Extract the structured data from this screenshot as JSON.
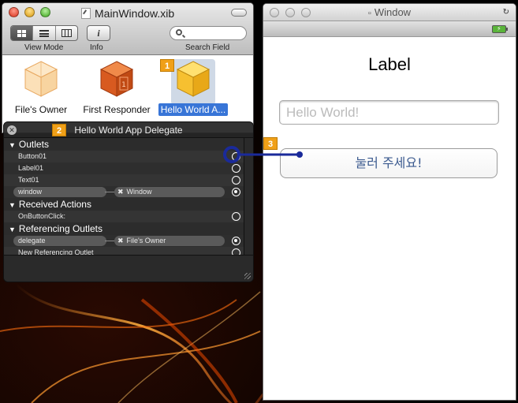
{
  "xib_window": {
    "title": "MainWindow.xib",
    "view_mode_label": "View Mode",
    "info_label": "Info",
    "search_label": "Search Field",
    "objects": [
      {
        "label": "File's Owner"
      },
      {
        "label": "First Responder"
      },
      {
        "label": "Hello World A..."
      }
    ],
    "badge_1": "1"
  },
  "hud": {
    "title": "Hello World App Delegate",
    "badge_2": "2",
    "sections": {
      "outlets": "Outlets",
      "received_actions": "Received Actions",
      "referencing_outlets": "Referencing Outlets"
    },
    "outlets": [
      "Button01",
      "Label01",
      "Text01",
      "window"
    ],
    "window_target": "Window",
    "actions": [
      "OnButtonClick:"
    ],
    "referencing": [
      "delegate",
      "New Referencing Outlet"
    ],
    "delegate_target": "File's Owner"
  },
  "iphone_window": {
    "title": "Window",
    "label_text": "Label",
    "textfield_placeholder": "Hello World!",
    "button_label": "눌러 주세요!",
    "badge_3": "3"
  },
  "colors": {
    "accent": "#3875d7",
    "badge": "#f0a018",
    "drag_line": "#1a2a9a",
    "button_text": "#3b5a8f"
  }
}
